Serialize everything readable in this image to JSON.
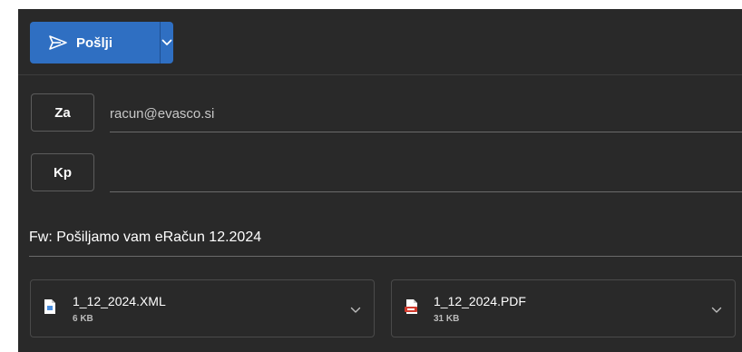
{
  "toolbar": {
    "send_label": "Pošlji",
    "send_icon": "paper-plane-icon",
    "dropdown_icon": "chevron-down-icon",
    "accent_color": "#2f6fc2"
  },
  "recipients": {
    "to_label": "Za",
    "to_value": "racun@evasco.si",
    "cc_label": "Kp",
    "cc_value": ""
  },
  "subject": "Fw: Pošiljamo vam eRačun 12.2024",
  "attachments": [
    {
      "name": "1_12_2024.XML",
      "size": "6 KB",
      "icon": "xml-file-icon"
    },
    {
      "name": "1_12_2024.PDF",
      "size": "31 KB",
      "icon": "pdf-file-icon"
    }
  ]
}
